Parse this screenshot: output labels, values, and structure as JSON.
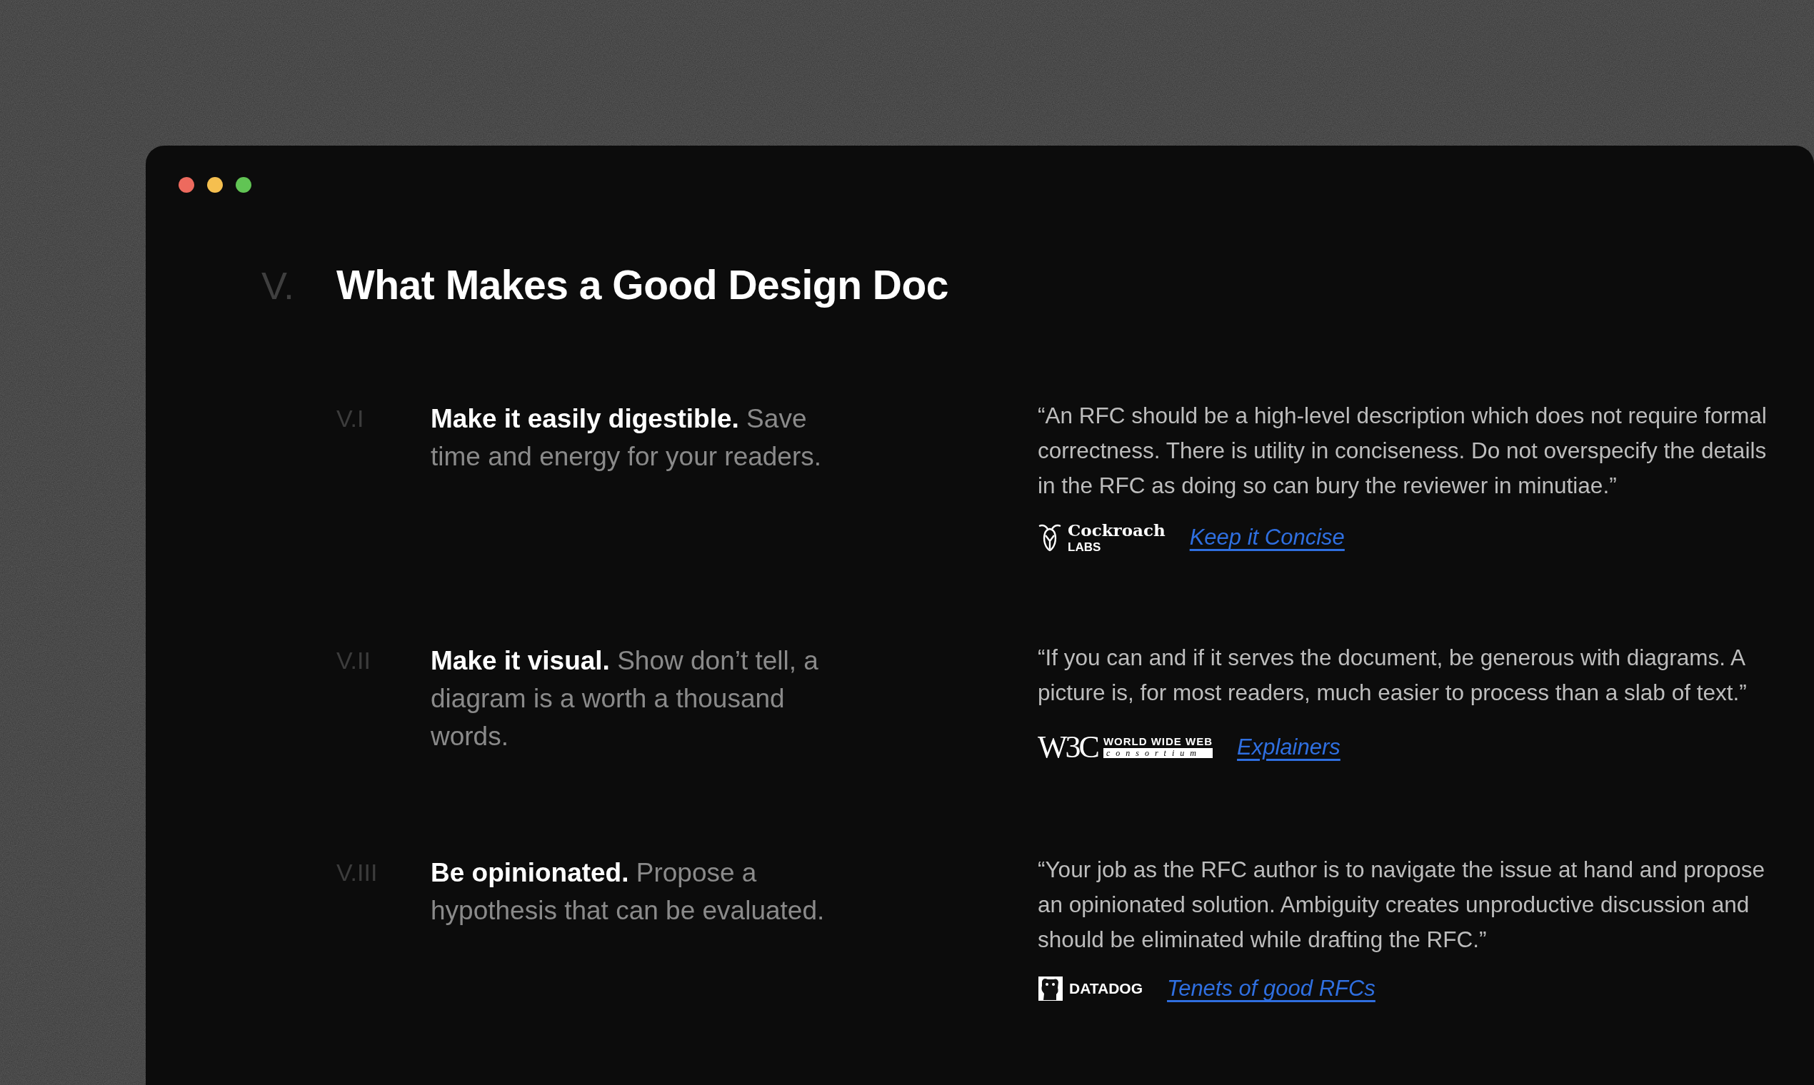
{
  "window": {
    "controls": [
      {
        "color": "#ed6a5e"
      },
      {
        "color": "#f5bf4f"
      },
      {
        "color": "#61c454"
      }
    ]
  },
  "heading": {
    "number": "V.",
    "title": "What Makes a Good Design Doc"
  },
  "sections": [
    {
      "number": "V.I",
      "text": "**Make it easily digestible.** Save time and energy for your readers.",
      "quote": "“An RFC should be a high-level description which does not require formal correctness. There is utility in conciseness. Do not overspecify the details in the RFC as doing so can bury the reviewer in minutiae.”",
      "source": {
        "kind": "cockroach",
        "logo_text": [
          "Cockroach",
          "LABS"
        ],
        "link": "Keep it Concise"
      }
    },
    {
      "number": "V.II",
      "text": "**Make it visual.** Show don’t tell, a diagram is a worth a thousand words.",
      "quote": "“If you can and if it serves the document, be generous with diagrams. A picture is, for most readers, much easier to process than a slab of text.”",
      "source": {
        "kind": "w3c",
        "logo_text": [
          "W3C",
          "WORLD WIDE WEB",
          "consortium"
        ],
        "link": "Explainers"
      }
    },
    {
      "number": "V.III",
      "text": "**Be opinionated.** Propose a hypothesis that can be evaluated.",
      "quote": "“Your job as the RFC author is to navigate the issue at hand and propose an opinionated solution. Ambiguity creates unproductive discussion and should be eliminated while drafting the RFC.”",
      "source": {
        "kind": "datadog",
        "logo_text": [
          "DATADOG"
        ],
        "link": "Tenets of good RFCs"
      }
    }
  ]
}
